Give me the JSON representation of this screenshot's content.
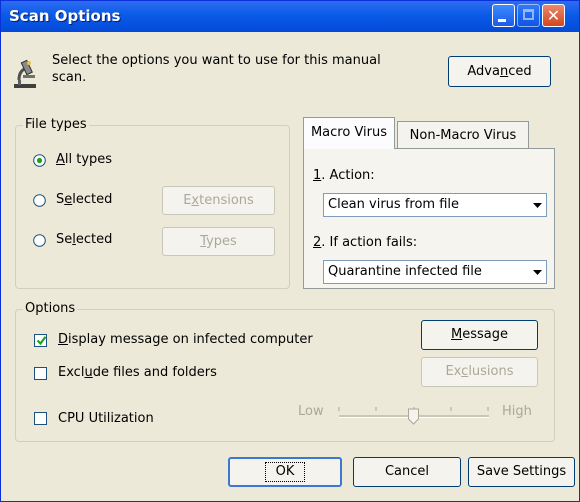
{
  "window": {
    "title": "Scan Options",
    "controls": {
      "minimize": "minimize",
      "maximize": "maximize",
      "close": "✕"
    }
  },
  "header": {
    "description": "Select the options you want to use for this manual",
    "description_line2": "scan.",
    "advanced_button": {
      "pre": "Adva",
      "u": "n",
      "post": "ced"
    }
  },
  "file_types": {
    "group_label": "File types",
    "options": [
      {
        "pre": "",
        "u": "A",
        "post": "ll types",
        "selected": true
      },
      {
        "pre": "S",
        "u": "e",
        "post": "lected",
        "selected": false
      },
      {
        "pre": "Se",
        "u": "l",
        "post": "ected",
        "selected": false
      }
    ],
    "extensions_button": {
      "pre": "E",
      "u": "x",
      "post": "tensions"
    },
    "types_button": {
      "pre": "",
      "u": "T",
      "post": "ypes"
    }
  },
  "tabs": {
    "items": [
      {
        "label": "Macro Virus",
        "active": true
      },
      {
        "label": "Non-Macro Virus",
        "active": false
      }
    ],
    "action_label": {
      "u": "1",
      "post": ". Action:"
    },
    "action_value": "Clean virus from file",
    "fails_label": {
      "u": "2",
      "post": ". If action fails:"
    },
    "fails_value": "Quarantine infected file"
  },
  "options": {
    "group_label": "Options",
    "display_message": {
      "pre": "",
      "u": "D",
      "post": "isplay message on infected computer",
      "checked": true
    },
    "exclude": {
      "pre": "Excl",
      "u": "u",
      "post": "de files and folders",
      "checked": false
    },
    "cpu": {
      "label": "CPU Utilization",
      "checked": false
    },
    "message_button": {
      "pre": "",
      "u": "M",
      "post": "essage"
    },
    "exclusions_button": {
      "pre": "Ex",
      "u": "c",
      "post": "lusions"
    },
    "slider": {
      "low": "Low",
      "high": "High",
      "level_fraction": 0.5
    }
  },
  "footer": {
    "ok": "OK",
    "cancel": "Cancel",
    "save": "Save Settings"
  },
  "colors": {
    "face": "#ECE9D8",
    "title_blue": "#0A5BE8",
    "disabled_text": "#ACA899",
    "check_green": "#21A121"
  }
}
